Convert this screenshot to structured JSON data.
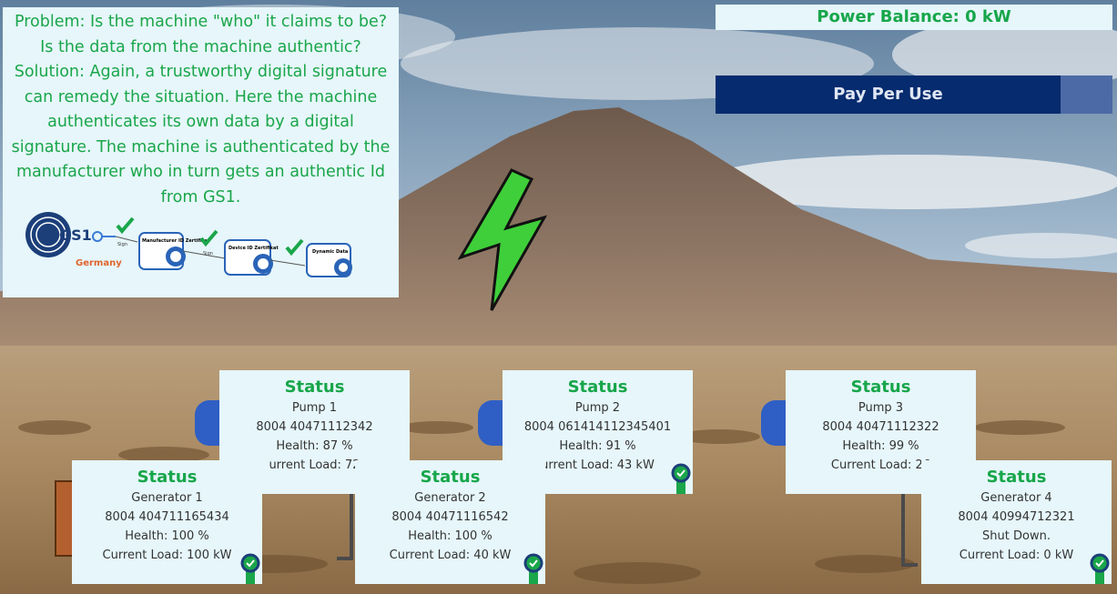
{
  "info_panel": {
    "text": "Problem: Is the machine \"who\" it claims to be? Is the data from the machine authentic? Solution: Again, a trustworthy digital signature can remedy the situation. Here the machine authenticates its own data by a digital signature. The machine is authenticated by the manufacturer who in turn gets an authentic Id from GS1.",
    "diagram": {
      "logo_text": "GS1",
      "country": "Germany",
      "sign_label": "Sign",
      "certs": [
        "Manufacturer ID Zertifikat",
        "Device ID Zertifikat",
        "Dynamic Data"
      ],
      "seal_text": "GS1"
    }
  },
  "power_balance": "Power Balance: 0 kW",
  "pay_per_use": "Pay Per Use",
  "cards": [
    {
      "title": "Status",
      "name": "Pump 1",
      "id": "8004 40471112342",
      "health": "Health: 87 %",
      "load": "urrent Load: 72",
      "verified": false
    },
    {
      "title": "Status",
      "name": "Pump 2",
      "id": "8004 061414112345401",
      "health": "Health: 91 %",
      "load": "urrent Load: 43 kW",
      "verified": true
    },
    {
      "title": "Status",
      "name": "Pump 3",
      "id": "8004 40471112322",
      "health": "Health: 99 %",
      "load": "Current Load: 26",
      "verified": false
    },
    {
      "title": "Status",
      "name": "Generator 1",
      "id": "8004 404711165434",
      "health": "Health: 100 %",
      "load": "Current Load: 100 kW",
      "verified": true
    },
    {
      "title": "Status",
      "name": "Generator 2",
      "id": "8004 40471116542",
      "health": "Health: 100 %",
      "load": "Current Load: 40 kW",
      "verified": true
    },
    {
      "title": "Status",
      "name": "Generator 4",
      "id": "8004 40994712321",
      "health": "Shut Down.",
      "load": "Current Load: 0 kW",
      "verified": true
    }
  ],
  "colors": {
    "accent_green": "#17a64a",
    "panel_bg": "#e6f6fa",
    "button_navy": "#062b6e",
    "button_tail": "#4c6aa6"
  }
}
